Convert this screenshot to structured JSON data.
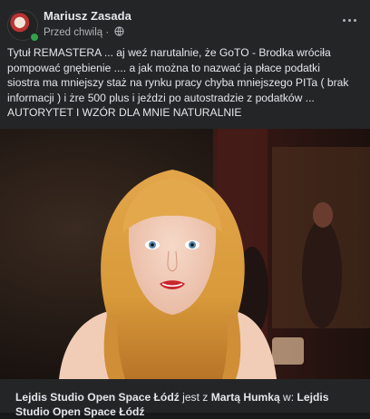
{
  "post": {
    "author": "Mariusz Zasada",
    "timestamp": "Przed chwilą",
    "separator": " · ",
    "privacy_icon": "globe-icon",
    "more_icon": "more-options-icon",
    "text": "Tytuł REMASTERA ... aj weź narutalnie, że GoTO - Brodka wróciła\npompować gnębienie .... a jak można to nazwać ja płace podatki\nsiostra ma mniejszy staż na rynku pracy chyba mniejszego PITa ( brak\ninformacji ) i żre 500 plus i jeździ po autostradzie z podatków ...\nAUTORYTET I WZÓR DLA MNIE NATURALNIE"
  },
  "caption": {
    "place": "Lejdis Studio Open Space Łódź",
    "with_text": " jest z ",
    "person": "Martą Humką",
    "in_text": " w: ",
    "place2": "Lejdis Studio Open Space Łódź"
  },
  "colors": {
    "background": "#242526",
    "text": "#e4e6eb",
    "secondary": "#b0b3b8",
    "online": "#31a24c"
  }
}
